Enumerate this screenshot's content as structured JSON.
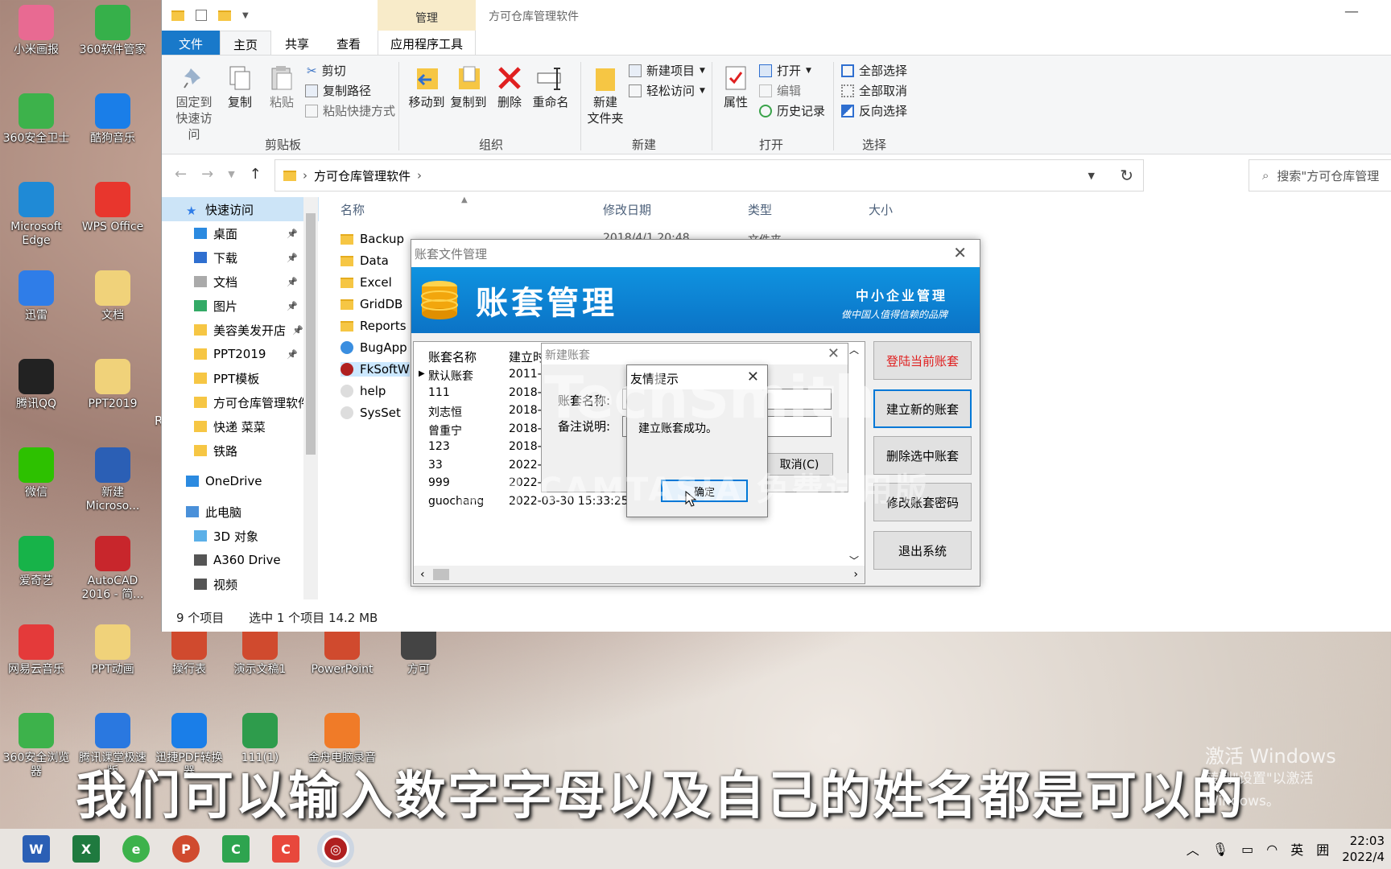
{
  "desktop": {
    "icons": [
      {
        "label": "小米画报",
        "color": "#e86a92"
      },
      {
        "label": "360软件管家",
        "color": "#36b04a"
      },
      {
        "label": "360安全卫士",
        "color": "#3db24b"
      },
      {
        "label": "酷狗音乐",
        "color": "#1a7ee8"
      },
      {
        "label": "Microsoft Edge",
        "color": "#1f8ad6"
      },
      {
        "label": "WPS Office",
        "color": "#e8362d"
      },
      {
        "label": "迅雷",
        "color": "#2f7de8"
      },
      {
        "label": "文档",
        "color": "#f0d27a"
      },
      {
        "label": "腾讯QQ",
        "color": "#222222"
      },
      {
        "label": "PPT2019",
        "color": "#f0d27a"
      },
      {
        "label": "微信",
        "color": "#2dc100"
      },
      {
        "label": "新建 Microso...",
        "color": "#2b5fb5"
      },
      {
        "label": "爱奇艺",
        "color": "#17b349"
      },
      {
        "label": "AutoCAD 2016 - 简...",
        "color": "#c8262c"
      },
      {
        "label": "网易云音乐",
        "color": "#e43a3a"
      },
      {
        "label": "PPT动画",
        "color": "#f0d27a"
      },
      {
        "label": "操行表",
        "color": "#d04a2e"
      },
      {
        "label": "演示文稿1",
        "color": "#d04a2e"
      },
      {
        "label": "PowerPoint",
        "color": "#d04a2e"
      },
      {
        "label": "方可",
        "color": "#444444"
      },
      {
        "label": "360安全浏览器",
        "color": "#3db24b"
      },
      {
        "label": "腾讯课堂极速版",
        "color": "#2a78e0"
      },
      {
        "label": "迅捷PDF转换器",
        "color": "#1a7ee8"
      },
      {
        "label": "111(1)",
        "color": "#2e9c4c"
      },
      {
        "label": "金舟电脑录音",
        "color": "#f07b28"
      }
    ],
    "partial_label": "R"
  },
  "explorer": {
    "title": "方可仓库管理软件",
    "manage_tab": "管理",
    "tabs": [
      "文件",
      "主页",
      "共享",
      "查看",
      "应用程序工具"
    ],
    "clipboard": {
      "pin": "固定到 快速访问",
      "copy": "复制",
      "paste": "粘贴",
      "cut": "剪切",
      "copy_path": "复制路径",
      "paste_shortcut": "粘贴快捷方式",
      "group": "剪贴板"
    },
    "organize": {
      "move_to": "移动到",
      "copy_to": "复制到",
      "delete": "删除",
      "rename": "重命名",
      "group": "组织"
    },
    "new": {
      "new_folder": "新建 文件夹",
      "new_item": "新建项目",
      "easy_access": "轻松访问",
      "group": "新建"
    },
    "open": {
      "properties": "属性",
      "open": "打开",
      "edit": "编辑",
      "history": "历史记录",
      "group": "打开"
    },
    "select": {
      "select_all": "全部选择",
      "select_none": "全部取消",
      "invert": "反向选择",
      "group": "选择"
    },
    "address": "方可仓库管理软件",
    "search_placeholder": "搜索\"方可仓库管理",
    "nav": [
      {
        "label": "快速访问",
        "kind": "star",
        "pin": false
      },
      {
        "label": "桌面",
        "kind": "desk",
        "pin": true
      },
      {
        "label": "下载",
        "kind": "down",
        "pin": true
      },
      {
        "label": "文档",
        "kind": "doc",
        "pin": true
      },
      {
        "label": "图片",
        "kind": "pic",
        "pin": true
      },
      {
        "label": "美容美发开店",
        "kind": "folder",
        "pin": true
      },
      {
        "label": "PPT2019",
        "kind": "folder",
        "pin": true
      },
      {
        "label": "PPT模板",
        "kind": "folder",
        "pin": false
      },
      {
        "label": "方可仓库管理软件",
        "kind": "folder",
        "pin": false
      },
      {
        "label": "快递 菜菜",
        "kind": "folder",
        "pin": false
      },
      {
        "label": "铁路",
        "kind": "folder",
        "pin": false
      },
      {
        "label": "OneDrive",
        "kind": "cloud",
        "pin": false
      },
      {
        "label": "此电脑",
        "kind": "pc",
        "pin": false
      },
      {
        "label": "3D 对象",
        "kind": "cube",
        "pin": false
      },
      {
        "label": "A360 Drive",
        "kind": "drive",
        "pin": false
      },
      {
        "label": "视频",
        "kind": "video",
        "pin": false
      }
    ],
    "columns": [
      "名称",
      "修改日期",
      "类型",
      "大小"
    ],
    "files": [
      "Backup",
      "Data",
      "Excel",
      "GridDB",
      "Reports",
      "BugApp",
      "FkSoftW",
      "help",
      "SysSet"
    ],
    "first_row_date": "2018/4/1 20:48",
    "first_row_type": "文件夹",
    "status_items": "9 个项目",
    "status_selected": "选中 1 个项目  14.2 MB"
  },
  "account_dialog": {
    "title": "账套文件管理",
    "banner_title": "账套管理",
    "banner_sub1": "中小企业管理",
    "banner_sub2": "做中国人值得信赖的品牌",
    "col_name": "账套名称",
    "col_date": "建立时",
    "rows": [
      {
        "name": "默认账套",
        "date": "2011-0"
      },
      {
        "name": "111",
        "date": "2018-0"
      },
      {
        "name": "刘志恒",
        "date": "2018-0"
      },
      {
        "name": "曾重宁",
        "date": "2018-0"
      },
      {
        "name": "123",
        "date": "2018-1"
      },
      {
        "name": "33",
        "date": "2022-0"
      },
      {
        "name": "999",
        "date": "2022-0"
      },
      {
        "name": "guochang",
        "date": "2022-03-30 15:33:25"
      }
    ],
    "buttons": [
      "登陆当前账套",
      "建立新的账套",
      "删除选中账套",
      "修改账套密码",
      "退出系统"
    ]
  },
  "new_dialog": {
    "title": "新建账套",
    "name_label": "账套名称:",
    "note_label": "备注说明:",
    "cancel": "取消(C)"
  },
  "tip_dialog": {
    "title": "友情提示",
    "message": "建立账套成功。",
    "ok": "确定"
  },
  "watermark": {
    "brand": "TechSmith",
    "sub": "使用 CAMTASIA 免费试用版"
  },
  "subtitle": "我们可以输入数字字母以及自己的姓名都是可以的",
  "activate": {
    "line1": "激活 Windows",
    "line2": "转到\"设置\"以激活 Windows。"
  },
  "tray": {
    "ime": "英",
    "time": "22:03",
    "date": "2022/4"
  }
}
